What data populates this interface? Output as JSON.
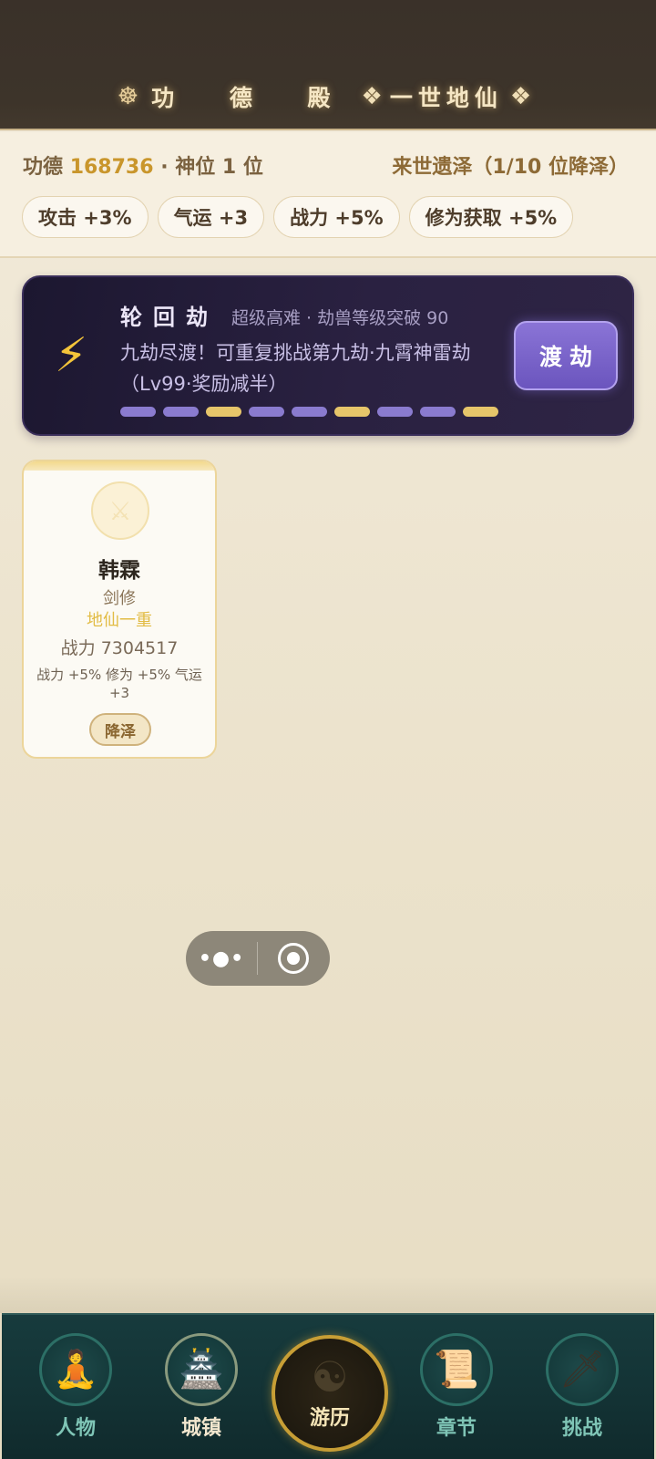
{
  "header": {
    "wheel_icon": "dharma-wheel-icon",
    "hall_title": "功 德 殿",
    "diamond_icon": "diamond-sparkle-icon",
    "realm_title": "一世地仙"
  },
  "stats": {
    "merit_label": "功德",
    "merit_value": "168736",
    "rank_text": "· 神位 1 位",
    "legacy_text": "来世遗泽（1/10 位降泽）",
    "chips": [
      "攻击 +3%",
      "气运 +3",
      "战力 +5%",
      "修为获取 +5%"
    ]
  },
  "tribulation": {
    "icon": "lightning-icon",
    "title": "轮回劫",
    "subtitle": "超级高难 · 劫兽等级突破 90",
    "description": "九劫尽渡！可重复挑战第九劫·九霄神雷劫（Lv99·奖励减半）",
    "progress_pattern": [
      "purple",
      "purple",
      "gold",
      "purple",
      "purple",
      "gold",
      "purple",
      "purple",
      "gold"
    ],
    "button_label": "渡劫",
    "colors": {
      "purple": "#8a7bcf",
      "gold": "#e6c56a",
      "button": "#7a64cc"
    }
  },
  "character": {
    "avatar_icon": "crossed-swords-icon",
    "name": "韩霖",
    "class": "剑修",
    "realm": "地仙一重",
    "power": "战力 7304517",
    "bonus": "战力 +5% 修为 +5% 气运 +3",
    "bless_label": "降泽"
  },
  "capsule": {
    "more_icon": "more-dots-icon",
    "close_icon": "close-target-icon"
  },
  "nav": {
    "items": [
      {
        "label": "人物",
        "icon": "character-icon"
      },
      {
        "label": "城镇",
        "icon": "town-icon"
      },
      {
        "label": "游历",
        "icon": "yin-yang-icon"
      },
      {
        "label": "章节",
        "icon": "scroll-icon"
      },
      {
        "label": "挑战",
        "icon": "sword-icon"
      }
    ]
  }
}
